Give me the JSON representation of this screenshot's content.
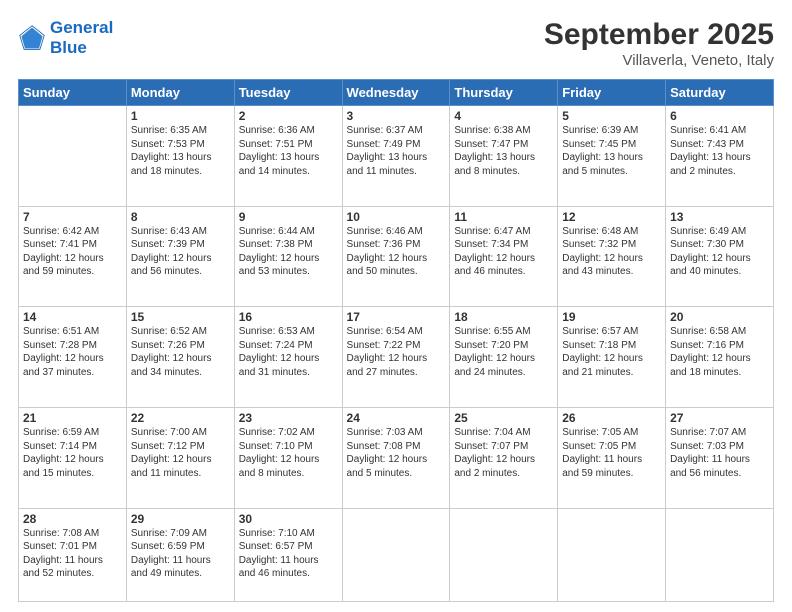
{
  "header": {
    "logo_line1": "General",
    "logo_line2": "Blue",
    "month": "September 2025",
    "location": "Villaverla, Veneto, Italy"
  },
  "weekdays": [
    "Sunday",
    "Monday",
    "Tuesday",
    "Wednesday",
    "Thursday",
    "Friday",
    "Saturday"
  ],
  "weeks": [
    [
      {
        "day": "",
        "sunrise": "",
        "sunset": "",
        "daylight": ""
      },
      {
        "day": "1",
        "sunrise": "Sunrise: 6:35 AM",
        "sunset": "Sunset: 7:53 PM",
        "daylight": "Daylight: 13 hours and 18 minutes."
      },
      {
        "day": "2",
        "sunrise": "Sunrise: 6:36 AM",
        "sunset": "Sunset: 7:51 PM",
        "daylight": "Daylight: 13 hours and 14 minutes."
      },
      {
        "day": "3",
        "sunrise": "Sunrise: 6:37 AM",
        "sunset": "Sunset: 7:49 PM",
        "daylight": "Daylight: 13 hours and 11 minutes."
      },
      {
        "day": "4",
        "sunrise": "Sunrise: 6:38 AM",
        "sunset": "Sunset: 7:47 PM",
        "daylight": "Daylight: 13 hours and 8 minutes."
      },
      {
        "day": "5",
        "sunrise": "Sunrise: 6:39 AM",
        "sunset": "Sunset: 7:45 PM",
        "daylight": "Daylight: 13 hours and 5 minutes."
      },
      {
        "day": "6",
        "sunrise": "Sunrise: 6:41 AM",
        "sunset": "Sunset: 7:43 PM",
        "daylight": "Daylight: 13 hours and 2 minutes."
      }
    ],
    [
      {
        "day": "7",
        "sunrise": "Sunrise: 6:42 AM",
        "sunset": "Sunset: 7:41 PM",
        "daylight": "Daylight: 12 hours and 59 minutes."
      },
      {
        "day": "8",
        "sunrise": "Sunrise: 6:43 AM",
        "sunset": "Sunset: 7:39 PM",
        "daylight": "Daylight: 12 hours and 56 minutes."
      },
      {
        "day": "9",
        "sunrise": "Sunrise: 6:44 AM",
        "sunset": "Sunset: 7:38 PM",
        "daylight": "Daylight: 12 hours and 53 minutes."
      },
      {
        "day": "10",
        "sunrise": "Sunrise: 6:46 AM",
        "sunset": "Sunset: 7:36 PM",
        "daylight": "Daylight: 12 hours and 50 minutes."
      },
      {
        "day": "11",
        "sunrise": "Sunrise: 6:47 AM",
        "sunset": "Sunset: 7:34 PM",
        "daylight": "Daylight: 12 hours and 46 minutes."
      },
      {
        "day": "12",
        "sunrise": "Sunrise: 6:48 AM",
        "sunset": "Sunset: 7:32 PM",
        "daylight": "Daylight: 12 hours and 43 minutes."
      },
      {
        "day": "13",
        "sunrise": "Sunrise: 6:49 AM",
        "sunset": "Sunset: 7:30 PM",
        "daylight": "Daylight: 12 hours and 40 minutes."
      }
    ],
    [
      {
        "day": "14",
        "sunrise": "Sunrise: 6:51 AM",
        "sunset": "Sunset: 7:28 PM",
        "daylight": "Daylight: 12 hours and 37 minutes."
      },
      {
        "day": "15",
        "sunrise": "Sunrise: 6:52 AM",
        "sunset": "Sunset: 7:26 PM",
        "daylight": "Daylight: 12 hours and 34 minutes."
      },
      {
        "day": "16",
        "sunrise": "Sunrise: 6:53 AM",
        "sunset": "Sunset: 7:24 PM",
        "daylight": "Daylight: 12 hours and 31 minutes."
      },
      {
        "day": "17",
        "sunrise": "Sunrise: 6:54 AM",
        "sunset": "Sunset: 7:22 PM",
        "daylight": "Daylight: 12 hours and 27 minutes."
      },
      {
        "day": "18",
        "sunrise": "Sunrise: 6:55 AM",
        "sunset": "Sunset: 7:20 PM",
        "daylight": "Daylight: 12 hours and 24 minutes."
      },
      {
        "day": "19",
        "sunrise": "Sunrise: 6:57 AM",
        "sunset": "Sunset: 7:18 PM",
        "daylight": "Daylight: 12 hours and 21 minutes."
      },
      {
        "day": "20",
        "sunrise": "Sunrise: 6:58 AM",
        "sunset": "Sunset: 7:16 PM",
        "daylight": "Daylight: 12 hours and 18 minutes."
      }
    ],
    [
      {
        "day": "21",
        "sunrise": "Sunrise: 6:59 AM",
        "sunset": "Sunset: 7:14 PM",
        "daylight": "Daylight: 12 hours and 15 minutes."
      },
      {
        "day": "22",
        "sunrise": "Sunrise: 7:00 AM",
        "sunset": "Sunset: 7:12 PM",
        "daylight": "Daylight: 12 hours and 11 minutes."
      },
      {
        "day": "23",
        "sunrise": "Sunrise: 7:02 AM",
        "sunset": "Sunset: 7:10 PM",
        "daylight": "Daylight: 12 hours and 8 minutes."
      },
      {
        "day": "24",
        "sunrise": "Sunrise: 7:03 AM",
        "sunset": "Sunset: 7:08 PM",
        "daylight": "Daylight: 12 hours and 5 minutes."
      },
      {
        "day": "25",
        "sunrise": "Sunrise: 7:04 AM",
        "sunset": "Sunset: 7:07 PM",
        "daylight": "Daylight: 12 hours and 2 minutes."
      },
      {
        "day": "26",
        "sunrise": "Sunrise: 7:05 AM",
        "sunset": "Sunset: 7:05 PM",
        "daylight": "Daylight: 11 hours and 59 minutes."
      },
      {
        "day": "27",
        "sunrise": "Sunrise: 7:07 AM",
        "sunset": "Sunset: 7:03 PM",
        "daylight": "Daylight: 11 hours and 56 minutes."
      }
    ],
    [
      {
        "day": "28",
        "sunrise": "Sunrise: 7:08 AM",
        "sunset": "Sunset: 7:01 PM",
        "daylight": "Daylight: 11 hours and 52 minutes."
      },
      {
        "day": "29",
        "sunrise": "Sunrise: 7:09 AM",
        "sunset": "Sunset: 6:59 PM",
        "daylight": "Daylight: 11 hours and 49 minutes."
      },
      {
        "day": "30",
        "sunrise": "Sunrise: 7:10 AM",
        "sunset": "Sunset: 6:57 PM",
        "daylight": "Daylight: 11 hours and 46 minutes."
      },
      {
        "day": "",
        "sunrise": "",
        "sunset": "",
        "daylight": ""
      },
      {
        "day": "",
        "sunrise": "",
        "sunset": "",
        "daylight": ""
      },
      {
        "day": "",
        "sunrise": "",
        "sunset": "",
        "daylight": ""
      },
      {
        "day": "",
        "sunrise": "",
        "sunset": "",
        "daylight": ""
      }
    ]
  ]
}
